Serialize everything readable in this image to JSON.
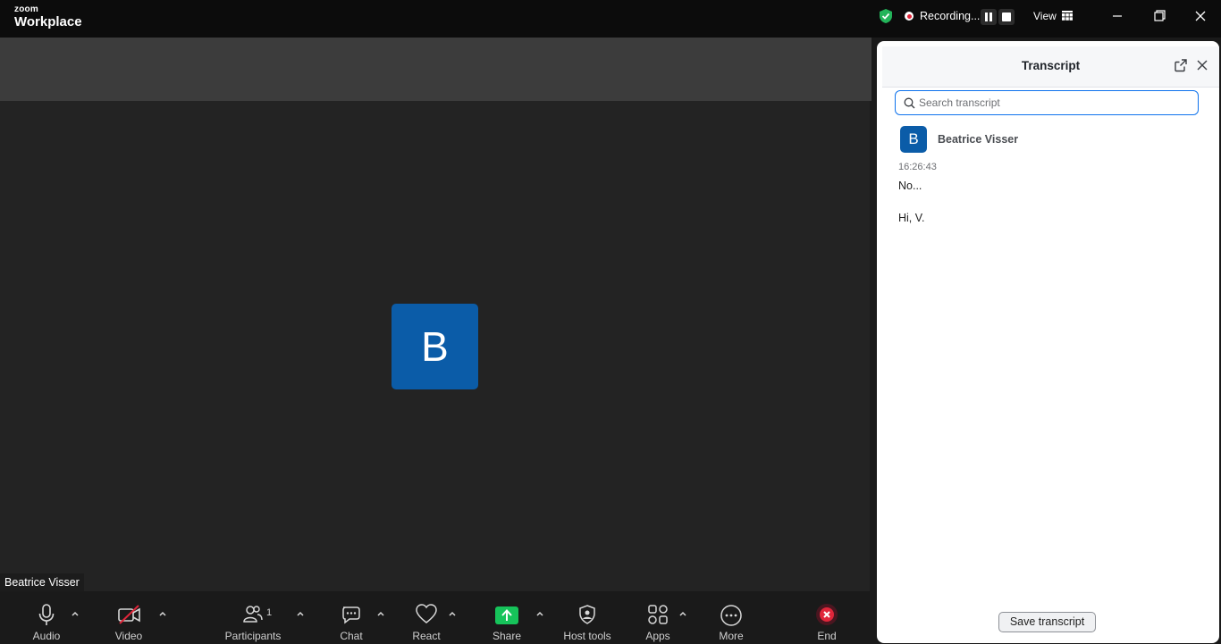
{
  "app": {
    "brand_small": "zoom",
    "brand_main": "Workplace"
  },
  "titlebar": {
    "recording_label": "Recording...",
    "view_label": "View"
  },
  "meeting": {
    "participant_initial": "B",
    "participant_name": "Beatrice Visser"
  },
  "toolbar": {
    "audio": "Audio",
    "video": "Video",
    "participants": "Participants",
    "participants_count": "1",
    "chat": "Chat",
    "react": "React",
    "share": "Share",
    "host_tools": "Host tools",
    "apps": "Apps",
    "more": "More",
    "end": "End"
  },
  "transcript": {
    "title": "Transcript",
    "search_placeholder": "Search transcript",
    "speaker_initial": "B",
    "speaker_name": "Beatrice Visser",
    "timestamp": "16:26:43",
    "lines": [
      "No...",
      "Hi, V."
    ],
    "save_label": "Save transcript"
  },
  "colors": {
    "accent": "#0e72ed",
    "avatar": "#0b5ca8",
    "share_green": "#16c35a",
    "end_red": "#e0263a"
  }
}
